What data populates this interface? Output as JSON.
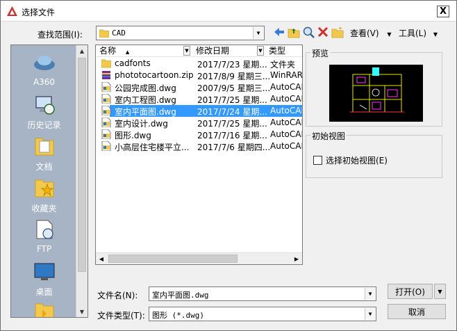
{
  "window": {
    "title": "选择文件",
    "close_label": "X"
  },
  "lookin": {
    "label": "查找范围(I):",
    "value": "CAD"
  },
  "toolbar": {
    "view_label": "查看(V)",
    "tools_label": "工具(L)"
  },
  "places": [
    {
      "label": "A360",
      "icon": "a360-icon"
    },
    {
      "label": "历史记录",
      "icon": "history-icon"
    },
    {
      "label": "文档",
      "icon": "documents-icon"
    },
    {
      "label": "收藏夹",
      "icon": "favorites-icon"
    },
    {
      "label": "FTP",
      "icon": "ftp-icon"
    },
    {
      "label": "桌面",
      "icon": "desktop-icon"
    },
    {
      "label": "",
      "icon": "folder-icon"
    }
  ],
  "list_headers": {
    "name": "名称",
    "date": "修改日期",
    "type": "类型"
  },
  "files": [
    {
      "name": "cadfonts",
      "date": "2017/7/23 星期...",
      "type": "文件夹",
      "icon": "folder-icon"
    },
    {
      "name": "phototocartoon.zip",
      "date": "2017/8/9 星期三...",
      "type": "WinRAR Z",
      "icon": "zip-icon"
    },
    {
      "name": "公园完成图.dwg",
      "date": "2007/9/5 星期三...",
      "type": "AutoCAD",
      "icon": "dwg-icon"
    },
    {
      "name": "室内工程图.dwg",
      "date": "2017/7/25 星期...",
      "type": "AutoCAD",
      "icon": "dwg-icon"
    },
    {
      "name": "室内平面图.dwg",
      "date": "2017/7/24 星期...",
      "type": "AutoCAD",
      "icon": "dwg-icon",
      "selected": true
    },
    {
      "name": "室内设计.dwg",
      "date": "2017/7/25 星期...",
      "type": "AutoCAD",
      "icon": "dwg-icon"
    },
    {
      "name": "图形.dwg",
      "date": "2017/7/16 星期...",
      "type": "AutoCAD",
      "icon": "dwg-icon"
    },
    {
      "name": "小高层住宅楼平立...",
      "date": "2017/7/6 星期四...",
      "type": "AutoCAD",
      "icon": "dwg-icon"
    }
  ],
  "preview": {
    "label": "预览"
  },
  "initial_view": {
    "label": "初始视图",
    "checkbox_label": "选择初始视图(E)"
  },
  "filename": {
    "label": "文件名(N):",
    "value": "室内平面图.dwg"
  },
  "filetype": {
    "label": "文件类型(T):",
    "value": "图形 (*.dwg)"
  },
  "buttons": {
    "open": "打开(O)",
    "cancel": "取消"
  },
  "colors": {
    "selection": "#3399ff",
    "places_bg": "#a7b4c6",
    "accent_red": "#d22d2d"
  }
}
